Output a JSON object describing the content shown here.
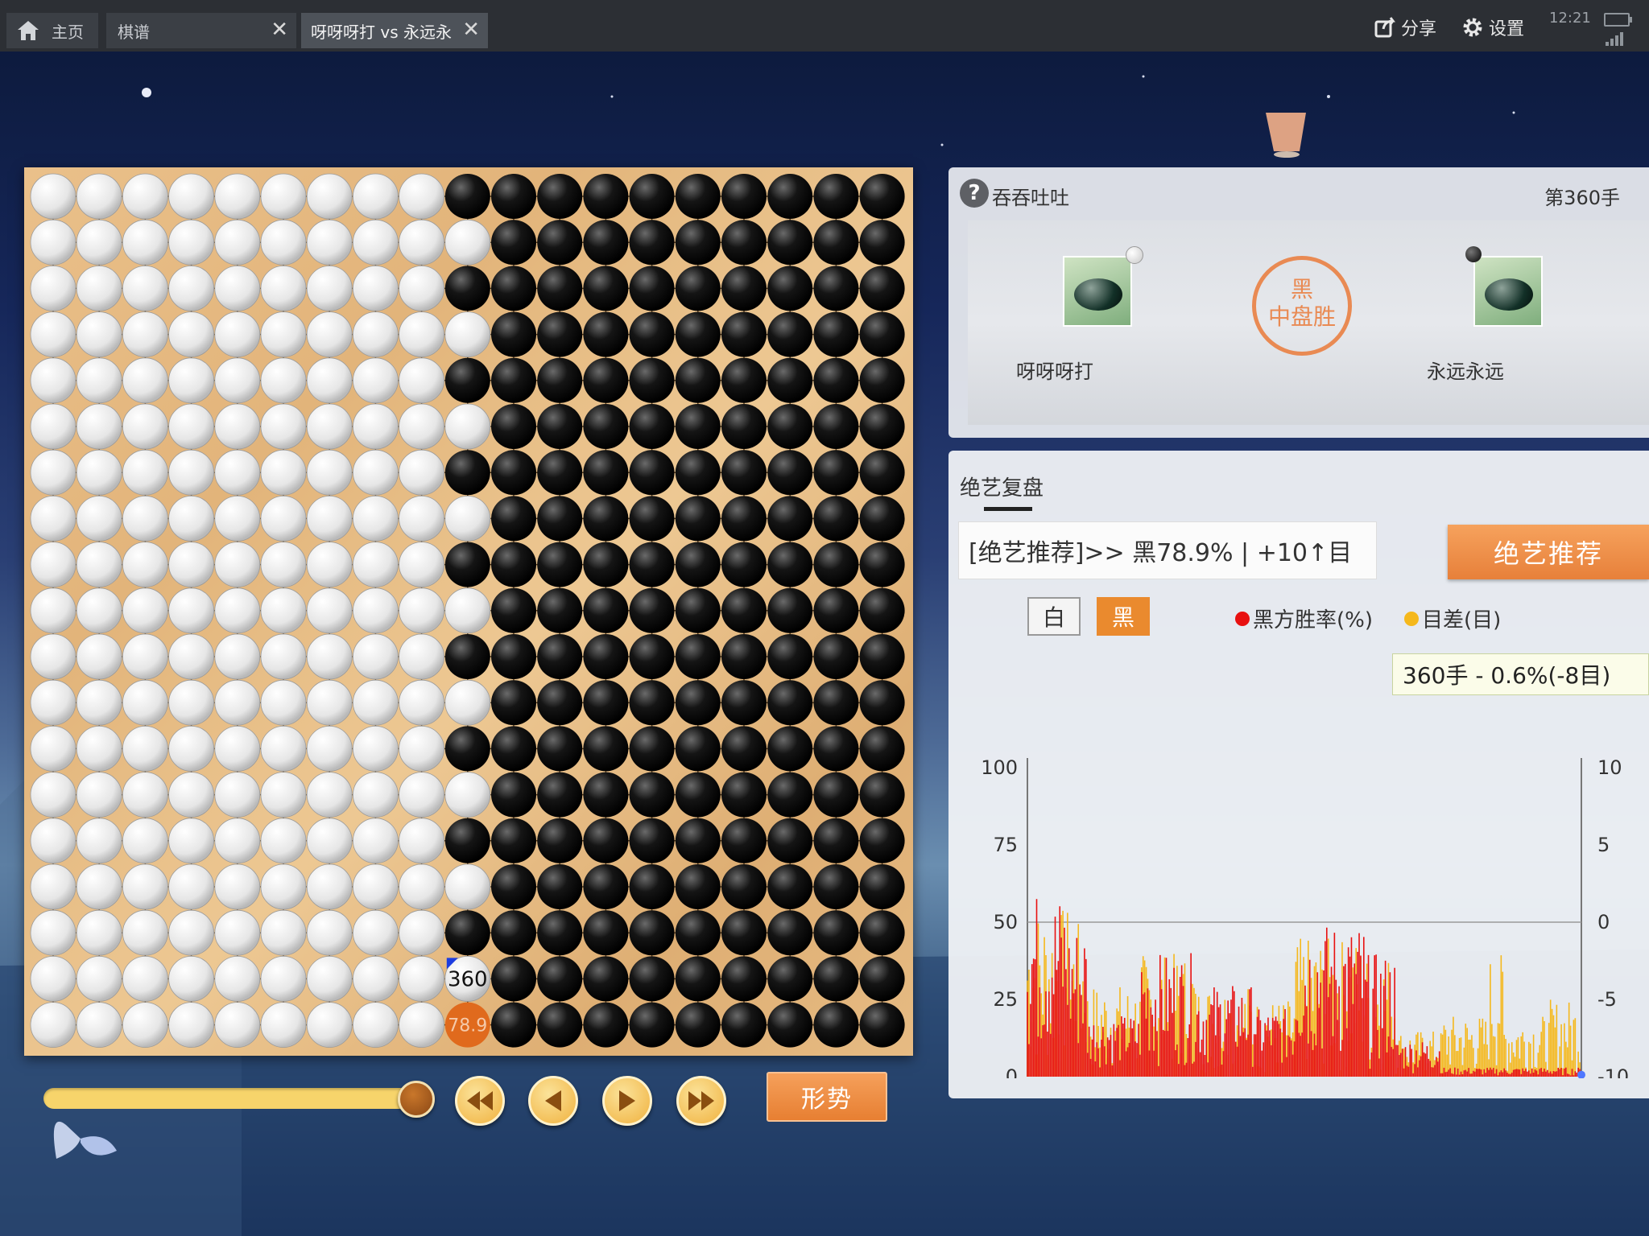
{
  "tabs": {
    "home_label": "主页",
    "qipu_label": "棋谱",
    "game_label": "呀呀呀打 vs 永远永",
    "close_glyph": "✕"
  },
  "toolbar": {
    "share_label": "分享",
    "settings_label": "设置",
    "time": "12:21"
  },
  "board": {
    "size": 19,
    "description_rows": "rows top to bottom; W=white, B=black",
    "rows": [
      "WWWWWWWWWBBBBBBBBBB",
      "WWWWWWWWWWBBBBBBBBB",
      "WWWWWWWWWBBBBBBBBBB",
      "WWWWWWWWWWBBBBBBBBB",
      "WWWWWWWWWBBBBBBBBBB",
      "WWWWWWWWWWBBBBBBBBB",
      "WWWWWWWWWBBBBBBBBBB",
      "WWWWWWWWWWBBBBBBBBB",
      "WWWWWWWWWBBBBBBBBBB",
      "WWWWWWWWWWBBBBBBBBB",
      "WWWWWWWWWBBBBBBBBBB",
      "WWWWWWWWWWBBBBBBBBB",
      "WWWWWWWWWBBBBBBBBBB",
      "WWWWWWWWWWBBBBBBBBB",
      "WWWWWWWWWBBBBBBBBBB",
      "WWWWWWWWWWBBBBBBBBB",
      "WWWWWWWWWBBBBBBBBBB",
      "WWWWWWWWWWBBBBBBBBB",
      "WWWWWWWWWOBBBBBBBBB"
    ],
    "last_move": {
      "row": 17,
      "col": 9,
      "label": "360"
    },
    "recommend": {
      "row": 18,
      "col": 9,
      "label": "78.9",
      "color": "#e06a1d"
    }
  },
  "controls": {
    "progress": 1.0,
    "shape_button_label": "形势"
  },
  "game_info": {
    "help_glyph": "?",
    "title": "吞吞吐吐",
    "move_label": "第360手",
    "player_white": "呀呀呀打",
    "player_black": "永远永远",
    "result_line1": "黑",
    "result_line2": "中盘胜"
  },
  "review": {
    "tab_label": "绝艺复盘",
    "recommendation_text": "[绝艺推荐]>> 黑78.9% | +10↑目",
    "recommend_button": "绝艺推荐",
    "white_toggle": "白",
    "black_toggle": "黑",
    "legend_winrate": "黑方胜率(%)",
    "legend_diff": "目差(目)",
    "tooltip": "360手 - 0.6%(-8目)"
  },
  "chart_data": {
    "type": "area",
    "x_range": [
      1,
      360
    ],
    "y_left": {
      "ticks": [
        "100",
        "75",
        "50",
        "25",
        "0"
      ],
      "range": [
        0,
        100
      ]
    },
    "y_right": {
      "ticks": [
        "10",
        "5",
        "0",
        "-5",
        "-10"
      ],
      "range": [
        -10,
        10
      ]
    },
    "colors": {
      "winrate": "#e81010",
      "diff": "#f5b81c"
    },
    "series": [
      {
        "name": "黑方胜率(%)",
        "segments": [
          {
            "from": 1,
            "to": 28,
            "min": 5,
            "max": 60
          },
          {
            "from": 28,
            "to": 40,
            "min": 3,
            "max": 50
          },
          {
            "from": 40,
            "to": 75,
            "min": 3,
            "max": 20
          },
          {
            "from": 75,
            "to": 110,
            "min": 3,
            "max": 40
          },
          {
            "from": 110,
            "to": 150,
            "min": 3,
            "max": 30
          },
          {
            "from": 150,
            "to": 175,
            "min": 3,
            "max": 22
          },
          {
            "from": 175,
            "to": 220,
            "min": 3,
            "max": 50
          },
          {
            "from": 220,
            "to": 240,
            "min": 2,
            "max": 40
          },
          {
            "from": 240,
            "to": 270,
            "min": 1,
            "max": 12
          },
          {
            "from": 270,
            "to": 360,
            "min": 0.3,
            "max": 3
          }
        ]
      },
      {
        "name": "目差(目)",
        "segments": [
          {
            "from": 1,
            "to": 28,
            "min": -10,
            "max": 1
          },
          {
            "from": 28,
            "to": 40,
            "min": -10,
            "max": 0
          },
          {
            "from": 40,
            "to": 75,
            "min": -10,
            "max": -4
          },
          {
            "from": 75,
            "to": 110,
            "min": -10,
            "max": -2
          },
          {
            "from": 110,
            "to": 150,
            "min": -10,
            "max": -4
          },
          {
            "from": 150,
            "to": 175,
            "min": -10,
            "max": -5
          },
          {
            "from": 175,
            "to": 220,
            "min": -10,
            "max": -1
          },
          {
            "from": 220,
            "to": 240,
            "min": -10,
            "max": -2
          },
          {
            "from": 240,
            "to": 270,
            "min": -10,
            "max": -7
          },
          {
            "from": 270,
            "to": 300,
            "min": -10,
            "max": -6
          },
          {
            "from": 300,
            "to": 310,
            "min": -10,
            "max": -2
          },
          {
            "from": 310,
            "to": 340,
            "min": -10,
            "max": -6
          },
          {
            "from": 340,
            "to": 360,
            "min": -10,
            "max": -5
          }
        ]
      }
    ],
    "current": {
      "move": 360,
      "winrate": 0.6,
      "diff": -8
    }
  }
}
